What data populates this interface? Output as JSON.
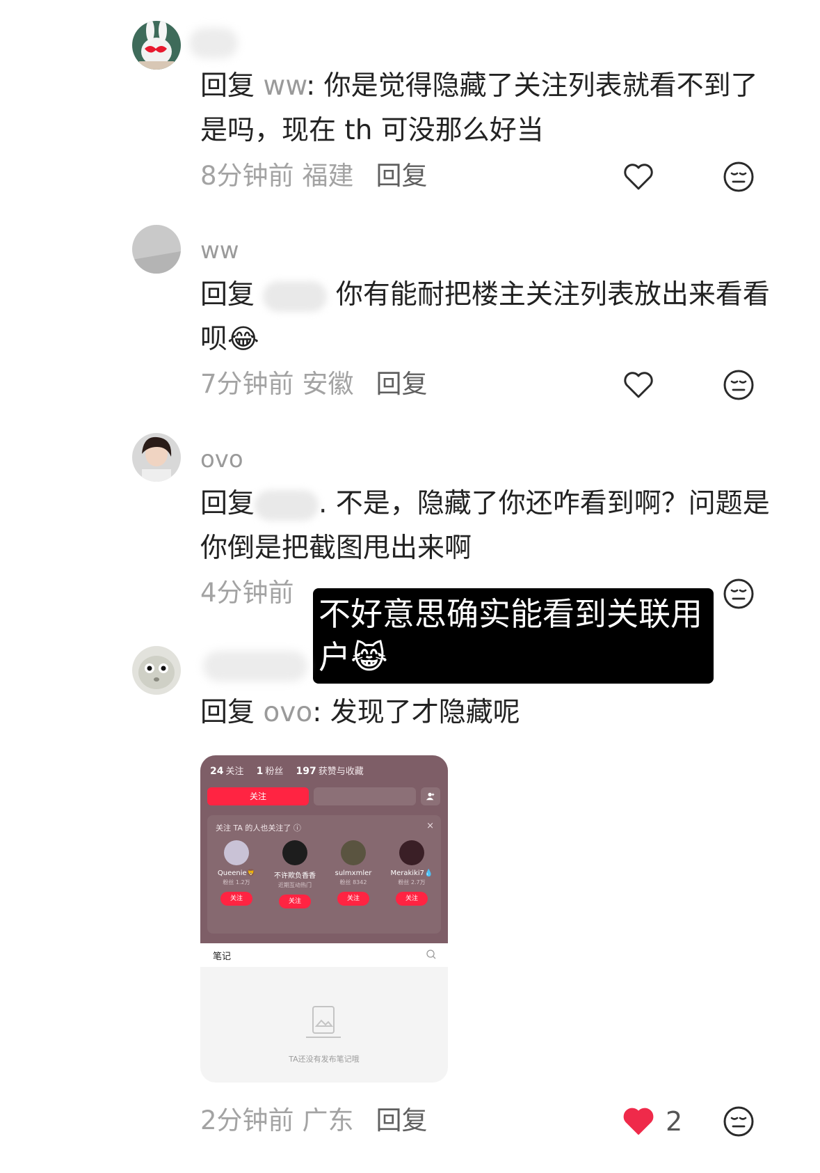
{
  "comments": [
    {
      "name": "",
      "reply_prefix": "回复",
      "reply_to": "ww",
      "text": ": 你是觉得隐藏了关注列表就看不到了是吗，现在 th 可没那么好当",
      "time": "8分钟前",
      "location": "福建",
      "reply_label": "回复"
    },
    {
      "name": "ww",
      "reply_prefix": "回复",
      "text": "你有能耐把楼主关注列表放出来看看呗",
      "emoji": "😂",
      "time": "7分钟前",
      "location": "安徽",
      "reply_label": "回复"
    },
    {
      "name": "ovo",
      "reply_prefix": "回复",
      "text": ". 不是，隐藏了你还咋看到啊？问题是你倒是把截图甩出来啊",
      "time": "4分钟前",
      "location": "",
      "reply_label": ""
    },
    {
      "name": "",
      "reply_prefix": "回复",
      "reply_to": "ovo",
      "text": ": 发现了才隐藏呢",
      "time": "2分钟前",
      "location": "广东",
      "reply_label": "回复",
      "like_count": "2"
    }
  ],
  "overlay": {
    "text": "不好意思确实能看到关联用户😹"
  },
  "screenshot": {
    "following_count": "24",
    "following_label": "关注",
    "fans_count": "1",
    "fans_label": "粉丝",
    "likes_count": "197",
    "likes_label": "获赞与收藏",
    "follow_button": "关注",
    "rec_title": "关注 TA 的人也关注了 ⓘ",
    "rec_close": "×",
    "rec_users": [
      {
        "name": "Queenie🦁",
        "sub": "粉丝 1.2万",
        "follow": "关注"
      },
      {
        "name": "不许欺负香香",
        "sub": "近期互动热门",
        "follow": "关注"
      },
      {
        "name": "sulmxmler",
        "sub": "粉丝 8342",
        "follow": "关注"
      },
      {
        "name": "Merakiki7💧",
        "sub": "粉丝 2.7万",
        "follow": "关注"
      }
    ],
    "notes_label": "笔记",
    "empty_text": "TA还没有发布笔记哦"
  },
  "colors": {
    "accent_red": "#ff2442",
    "like_red": "#ef2a4a",
    "meta_gray": "#a3a3a3"
  },
  "icons": [
    "heart-outline-icon",
    "heart-filled-icon",
    "dislike-face-icon",
    "search-icon",
    "add-person-icon",
    "empty-notes-icon"
  ]
}
